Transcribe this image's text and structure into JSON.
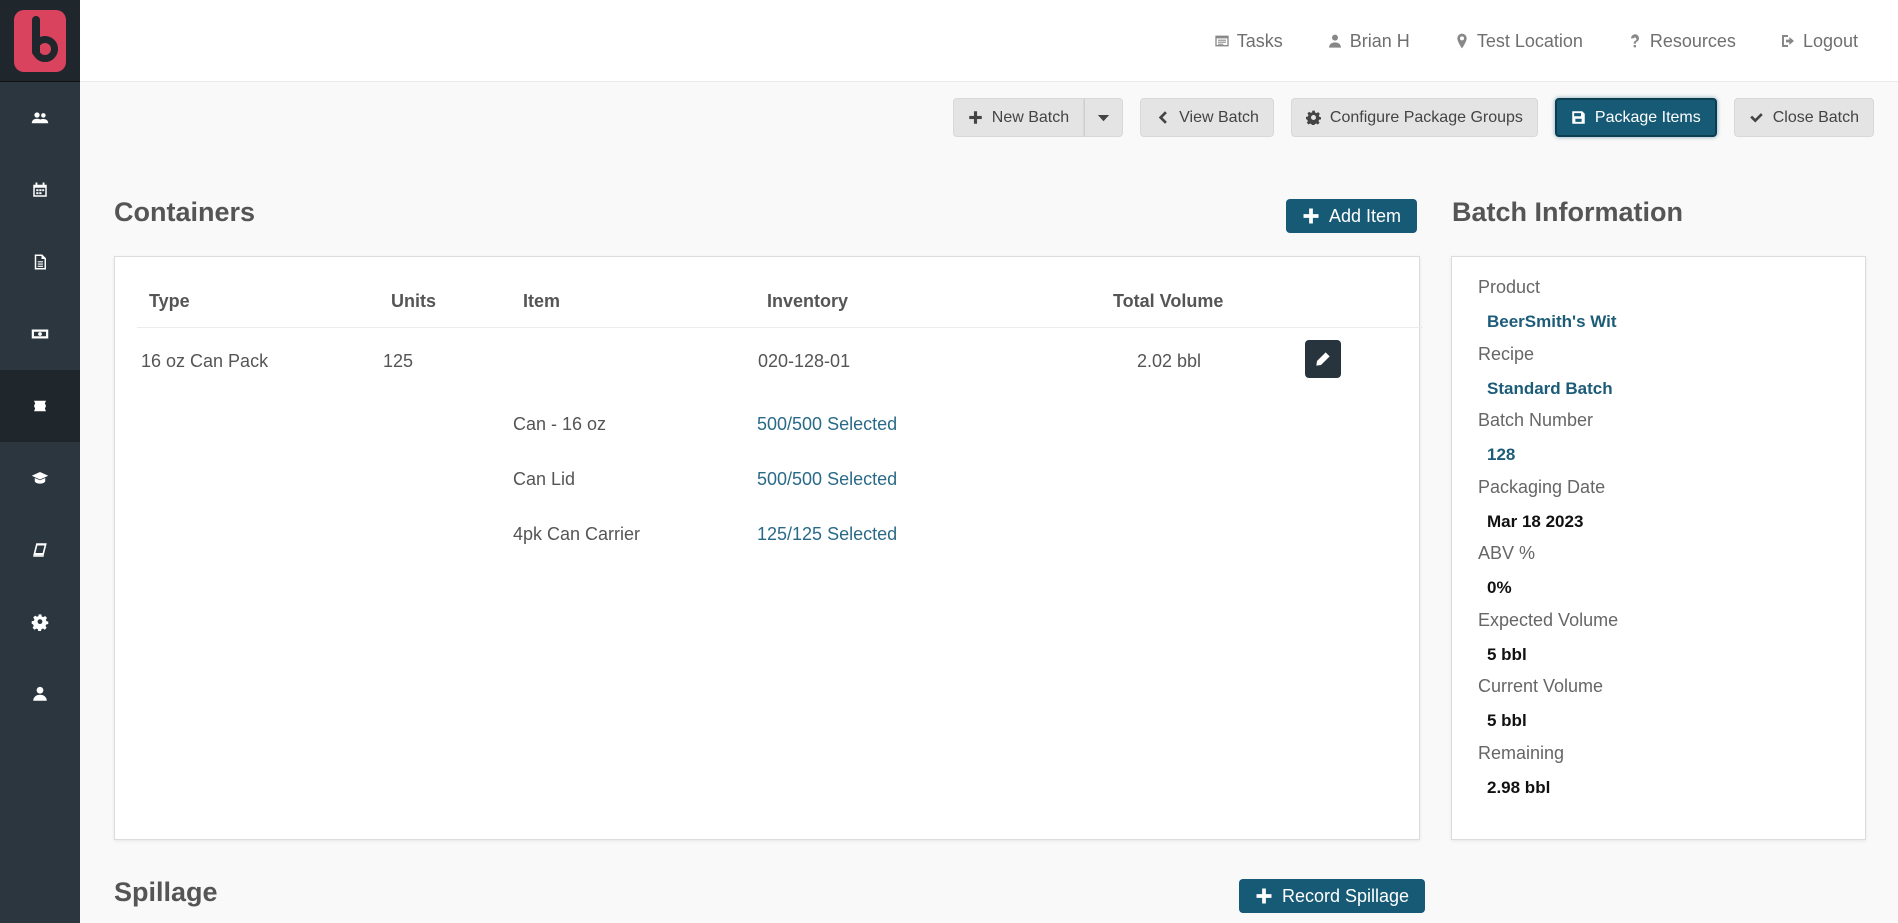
{
  "topnav": [
    {
      "label": "Tasks",
      "icon": "tasks-icon"
    },
    {
      "label": "Brian H",
      "icon": "user-icon"
    },
    {
      "label": "Test Location",
      "icon": "map-marker-icon"
    },
    {
      "label": "Resources",
      "icon": "question-icon"
    },
    {
      "label": "Logout",
      "icon": "logout-icon"
    }
  ],
  "sidebar": {
    "items": [
      {
        "name": "users",
        "icon": "users-icon"
      },
      {
        "name": "calendar",
        "icon": "calendar-icon"
      },
      {
        "name": "documents",
        "icon": "document-icon"
      },
      {
        "name": "money",
        "icon": "money-icon"
      },
      {
        "name": "batches",
        "icon": "ticket-icon",
        "active": true
      },
      {
        "name": "education",
        "icon": "graduation-cap-icon"
      },
      {
        "name": "book",
        "icon": "book-icon"
      },
      {
        "name": "settings",
        "icon": "gear-icon"
      },
      {
        "name": "account",
        "icon": "user-icon"
      }
    ]
  },
  "toolbar": {
    "new_batch": "New Batch",
    "view_batch": "View Batch",
    "configure": "Configure Package Groups",
    "package_items": "Package Items",
    "close_batch": "Close Batch"
  },
  "containers": {
    "title": "Containers",
    "add_item": "Add Item",
    "columns": [
      "Type",
      "Units",
      "Item",
      "Inventory",
      "Total Volume"
    ],
    "row": {
      "type": "16 oz Can Pack",
      "units": "125",
      "inventory": "020-128-01",
      "total_volume": "2.02 bbl"
    },
    "items": [
      {
        "item": "Can - 16 oz",
        "inventory": "500/500 Selected"
      },
      {
        "item": "Can Lid",
        "inventory": "500/500 Selected"
      },
      {
        "item": "4pk Can Carrier",
        "inventory": "125/125 Selected"
      }
    ]
  },
  "batch_info": {
    "title": "Batch Information",
    "fields": [
      {
        "label": "Product",
        "value": "BeerSmith's Wit",
        "link": true
      },
      {
        "label": "Recipe",
        "value": "Standard Batch",
        "link": true
      },
      {
        "label": "Batch Number",
        "value": "128",
        "link": true
      },
      {
        "label": "Packaging Date",
        "value": "Mar 18 2023",
        "link": false
      },
      {
        "label": "ABV %",
        "value": "0%",
        "link": false
      },
      {
        "label": "Expected Volume",
        "value": "5 bbl",
        "link": false
      },
      {
        "label": "Current Volume",
        "value": "5 bbl",
        "link": false
      },
      {
        "label": "Remaining",
        "value": "2.98 bbl",
        "link": false
      }
    ]
  },
  "spillage": {
    "title": "Spillage",
    "record": "Record Spillage"
  }
}
